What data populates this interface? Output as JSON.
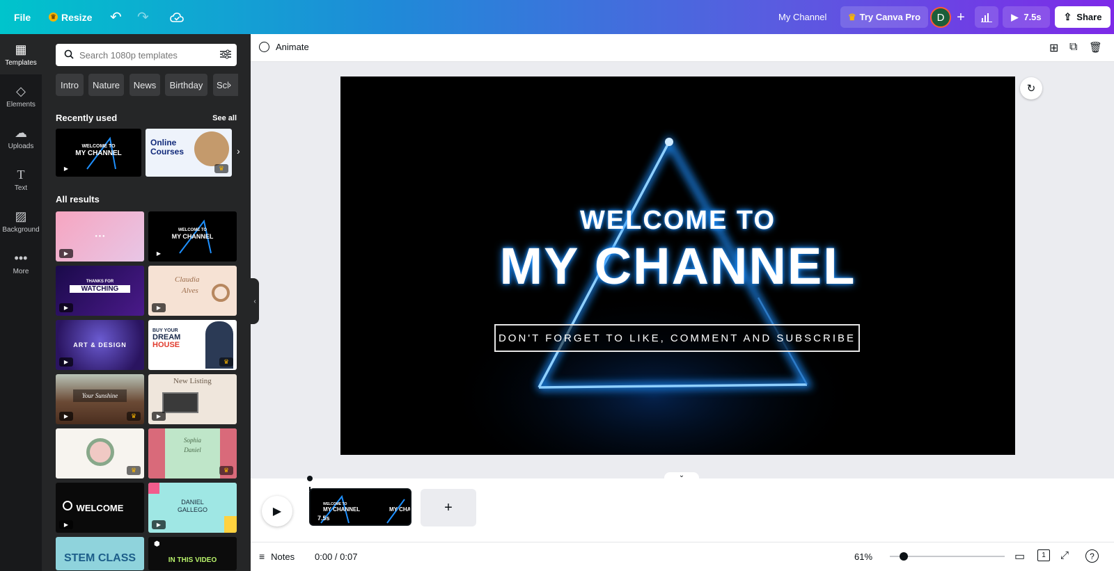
{
  "topbar": {
    "file": "File",
    "resize": "Resize",
    "design_name": "My Channel",
    "try_pro": "Try Canva Pro",
    "avatar_initial": "D",
    "play_duration": "7.5s",
    "share": "Share",
    "gradient": [
      "#00c4cc",
      "#7d2ae8"
    ]
  },
  "rail": {
    "items": [
      {
        "label": "Templates",
        "icon": "templates-icon"
      },
      {
        "label": "Elements",
        "icon": "elements-icon"
      },
      {
        "label": "Uploads",
        "icon": "uploads-icon"
      },
      {
        "label": "Text",
        "icon": "text-icon"
      },
      {
        "label": "Background",
        "icon": "background-icon"
      },
      {
        "label": "More",
        "icon": "more-icon"
      }
    ]
  },
  "panel": {
    "search_placeholder": "Search 1080p templates",
    "chips": [
      "Intro",
      "Nature",
      "News",
      "Birthday",
      "Sch"
    ],
    "recently_used_title": "Recently used",
    "see_all": "See all",
    "recent_texts": [
      "WELCOME TO",
      "MY CHANNEL",
      "Online",
      "Courses"
    ],
    "all_results_title": "All results",
    "thumb_texts": [
      "THANKS FOR",
      "WATCHING",
      "Claudia",
      "Alves",
      "ART & DESIGN",
      "BUY YOUR",
      "DREAM",
      "HOUSE",
      "Your Sunshine",
      "New Listing",
      "Sophia",
      "Daniel",
      "WELCOME",
      "DANIEL",
      "GALLEGO",
      "STEM CLASS",
      "IN THIS VIDEO"
    ]
  },
  "editor": {
    "animate": "Animate"
  },
  "canvas": {
    "line1": "WELCOME TO",
    "line2": "MY CHANNEL",
    "tagline": "DON'T FORGET TO LIKE, COMMENT AND SUBSCRIBE",
    "glow_color": "#1e90ff"
  },
  "timeline": {
    "page_duration": "7.5s",
    "thumb_line1": "WELCOME TO",
    "thumb_line2": "MY CHANNEL",
    "add_page": "+"
  },
  "bottombar": {
    "notes": "Notes",
    "time": "0:00 / 0:07",
    "zoom": "61%",
    "zoom_fraction": 0.12,
    "page_count": "1",
    "help": "?"
  }
}
